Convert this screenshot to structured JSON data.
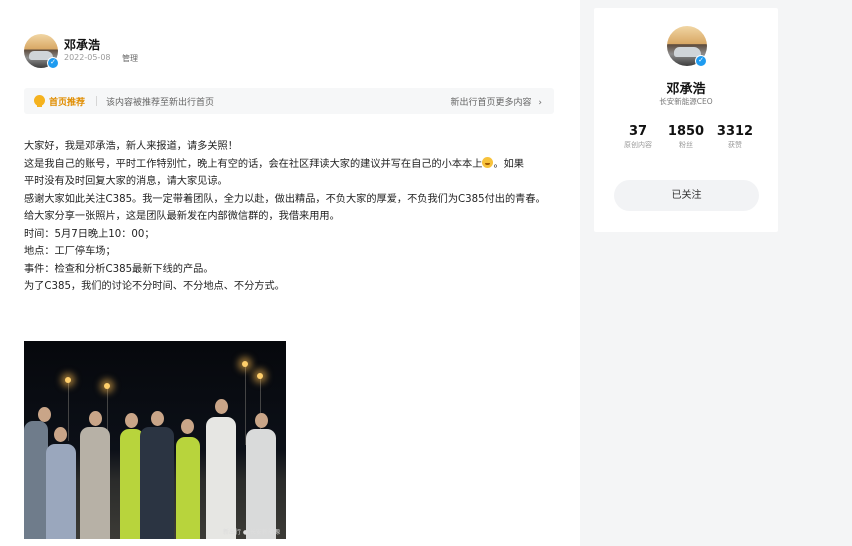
{
  "post": {
    "author_name": "邓承浩",
    "date": "2022-05-08",
    "manage_label": "管理",
    "verified_icon": "check-icon"
  },
  "banner": {
    "tag": "首页推荐",
    "text": "该内容被推荐至新出行首页",
    "link": "新出行首页更多内容",
    "link_arrow": "›",
    "icon": "medal-icon"
  },
  "article": {
    "paragraphs": [
      "大家好，我是邓承浩，新人来报道，请多关照！",
      "这是我自己的账号，平时工作特别忙，晚上有空的话，会在社区拜读大家的建议并写在自己的小本本上",
      "平时没有及时回复大家的消息，请大家见谅。",
      "感谢大家如此关注C385。我一定带着团队，全力以赴，做出精品，不负大家的厚爱，不负我们为C385付出的青春。",
      "给大家分享一张照片，这是团队最新发在内部微信群的，我借来用用。",
      "时间：5月7日晚上10：00；",
      "地点：工厂停车场；",
      "事件：检查和分析C385最新下线的产品。",
      "为了C385，我们的讨论不分时间、不分地点、不分方式。"
    ],
    "line2_suffix": "。如果",
    "emoji": "grinning-face-emoji"
  },
  "photo": {
    "watermark": "新出行 ● 长安新能源"
  },
  "profile_card": {
    "name": "邓承浩",
    "title": "长安新能源CEO",
    "stats": [
      {
        "value": "37",
        "label": "原创内容"
      },
      {
        "value": "1850",
        "label": "粉丝"
      },
      {
        "value": "3312",
        "label": "获赞"
      }
    ],
    "follow_label": "已关注"
  },
  "colors": {
    "accent_orange": "#e08d00",
    "verified_blue": "#1e9bf0",
    "page_bg": "#f4f5f6"
  }
}
